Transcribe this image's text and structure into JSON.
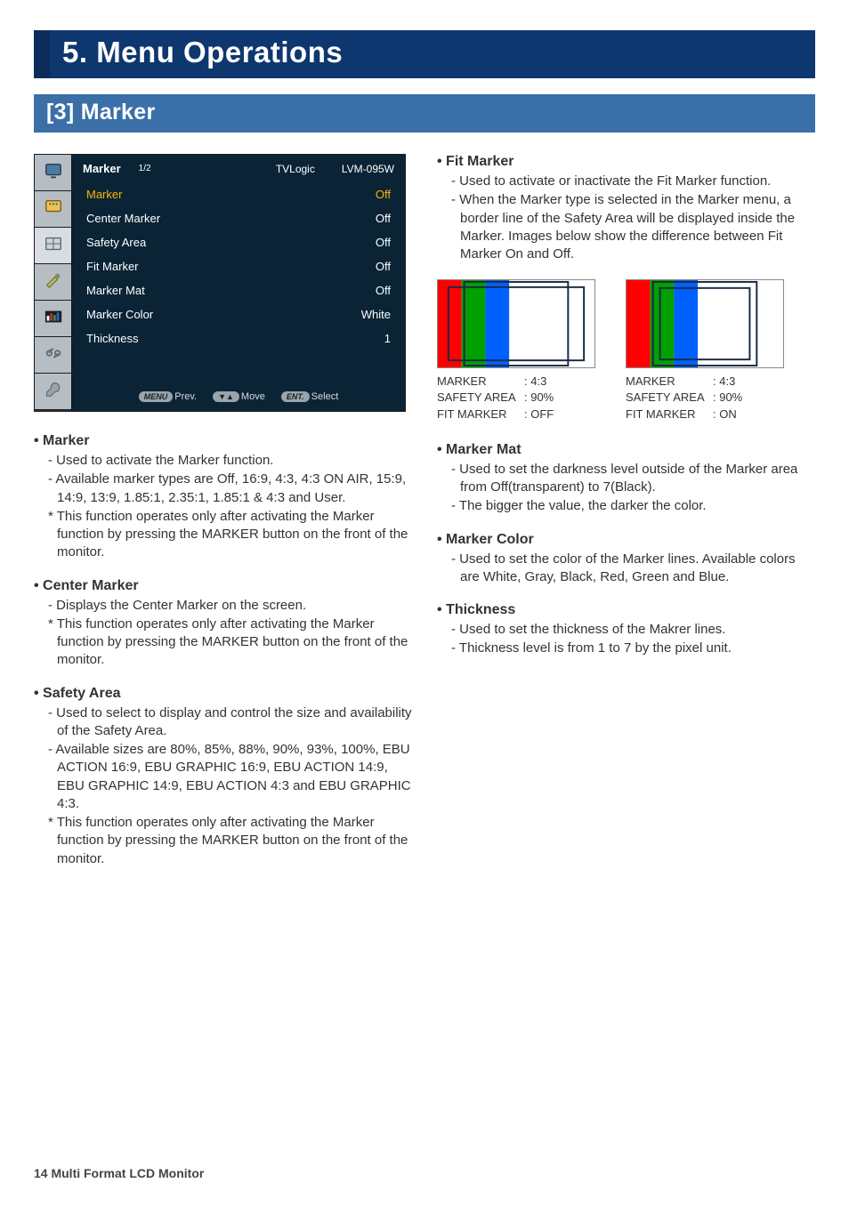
{
  "chapter": "5. Menu Operations",
  "section": "[3] Marker",
  "osd": {
    "title": "Marker",
    "page": "1/2",
    "brand": "TVLogic",
    "model": "LVM-095W",
    "rows": [
      {
        "label": "Marker",
        "value": "Off",
        "selected": true
      },
      {
        "label": "Center Marker",
        "value": "Off"
      },
      {
        "label": "Safety Area",
        "value": "Off"
      },
      {
        "label": "Fit Marker",
        "value": "Off"
      },
      {
        "label": "Marker Mat",
        "value": "Off"
      },
      {
        "label": "Marker Color",
        "value": "White"
      },
      {
        "label": "Thickness",
        "value": "1"
      }
    ],
    "footer": {
      "prev_btn": "MENU",
      "prev_lbl": "Prev.",
      "move_btn": "▼▲",
      "move_lbl": "Move",
      "select_btn": "ENT.",
      "select_lbl": "Select"
    }
  },
  "left_items": [
    {
      "title": "Marker",
      "bullets": [
        {
          "t": "dash",
          "text": "Used to activate the Marker function."
        },
        {
          "t": "dash",
          "text": "Available marker types are Off, 16:9, 4:3, 4:3 ON AIR, 15:9, 14:9, 13:9, 1.85:1, 2.35:1, 1.85:1 & 4:3 and User."
        },
        {
          "t": "star",
          "text": "This function operates only after activating the Marker function by pressing the MARKER button on the front of the monitor."
        }
      ]
    },
    {
      "title": "Center Marker",
      "bullets": [
        {
          "t": "dash",
          "text": "Displays the Center Marker on the screen."
        },
        {
          "t": "star",
          "text": "This function operates only after activating the Marker function by pressing the MARKER button on the front of the monitor."
        }
      ]
    },
    {
      "title": "Safety Area",
      "bullets": [
        {
          "t": "dash",
          "text": "Used to select to display and control the size and availability of the Safety Area."
        },
        {
          "t": "dash",
          "text": "Available sizes are 80%, 85%, 88%, 90%, 93%, 100%,  EBU ACTION 16:9, EBU GRAPHIC 16:9, EBU ACTION 14:9, EBU GRAPHIC 14:9, EBU ACTION 4:3 and EBU GRAPHIC 4:3."
        },
        {
          "t": "star",
          "text": "This function operates only after activating the Marker function by pressing the MARKER button on the front of the monitor."
        }
      ]
    }
  ],
  "right_items_top": [
    {
      "title": "Fit Marker",
      "bullets": [
        {
          "t": "dash",
          "text": "Used to activate or inactivate the Fit Marker function."
        },
        {
          "t": "dash",
          "text": "When the Marker type is selected in the Marker menu, a border line of the Safety Area will be displayed inside the Marker. Images below show the difference between Fit Marker On and Off."
        }
      ]
    }
  ],
  "diagrams": {
    "left": {
      "marker_k": "MARKER",
      "marker_v": ": 4:3",
      "safety_k": "SAFETY AREA",
      "safety_v": ": 90%",
      "fit_k": "FIT MARKER",
      "fit_v": ": OFF"
    },
    "right": {
      "marker_k": "MARKER",
      "marker_v": ": 4:3",
      "safety_k": "SAFETY AREA",
      "safety_v": ": 90%",
      "fit_k": "FIT MARKER",
      "fit_v": ": ON"
    }
  },
  "right_items_bottom": [
    {
      "title": "Marker Mat",
      "bullets": [
        {
          "t": "dash",
          "text": "Used to set the darkness level outside of the Marker area from Off(transparent) to 7(Black)."
        },
        {
          "t": "dash",
          "text": "The bigger the value, the darker the color."
        }
      ]
    },
    {
      "title": "Marker Color",
      "bullets": [
        {
          "t": "dash",
          "text": "Used to set the color of the Marker lines. Available colors are White, Gray, Black, Red, Green and Blue."
        }
      ]
    },
    {
      "title": "Thickness",
      "bullets": [
        {
          "t": "dash",
          "text": "Used to set the thickness of the Makrer lines."
        },
        {
          "t": "dash",
          "text": "Thickness level is from 1 to 7 by the pixel unit."
        }
      ]
    }
  ],
  "footer": "14 Multi Format LCD Monitor"
}
